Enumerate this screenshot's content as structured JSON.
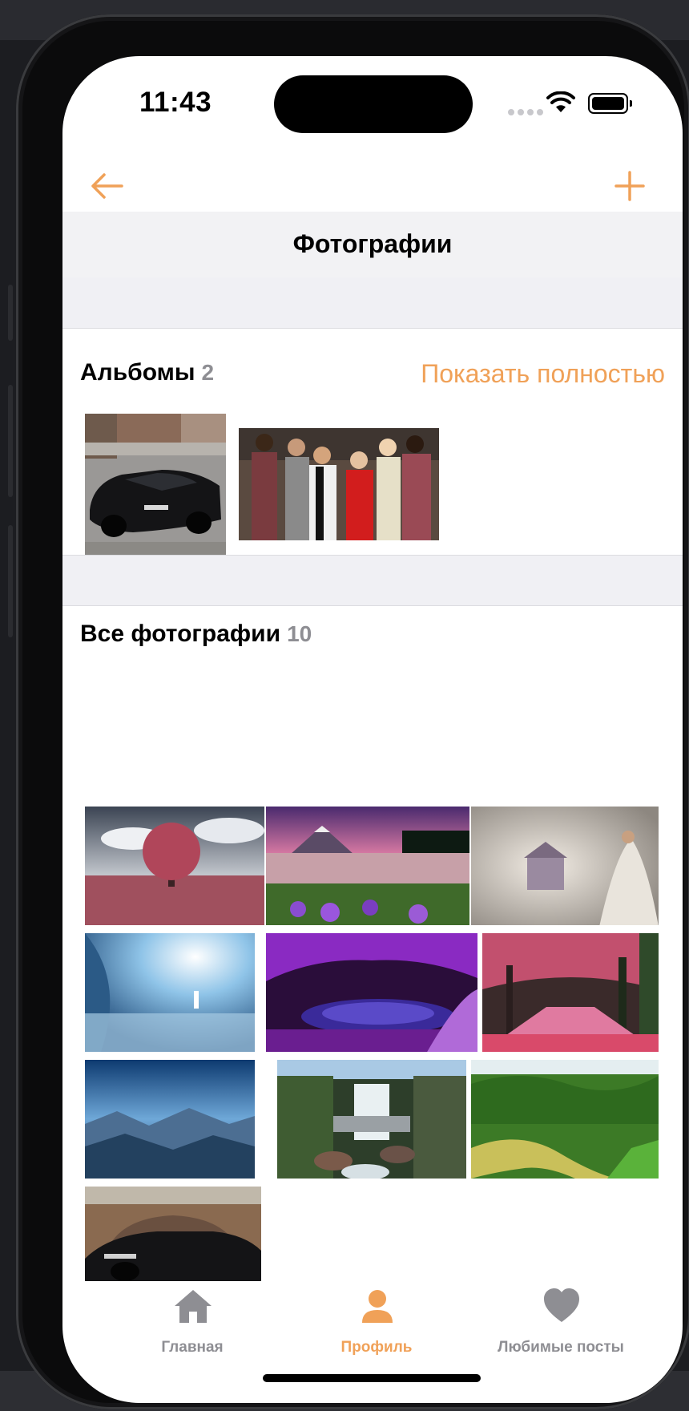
{
  "status_bar": {
    "time": "11:43"
  },
  "nav": {
    "title": "Фотографии",
    "back_icon": "arrow-left-icon",
    "add_icon": "plus-icon"
  },
  "albums": {
    "title": "Альбомы",
    "count": "2",
    "show_all": "Показать полностью"
  },
  "all_photos": {
    "title": "Все фотографии",
    "count": "10"
  },
  "tabbar": {
    "items": [
      {
        "label": "Главная",
        "icon": "home-icon",
        "active": false
      },
      {
        "label": "Профиль",
        "icon": "person-icon",
        "active": true
      },
      {
        "label": "Любимые посты",
        "icon": "heart-icon",
        "active": false
      }
    ]
  },
  "colors": {
    "accent": "#f0a158",
    "inactive": "#8e8e93",
    "title_bar": "#f2f2f4"
  }
}
